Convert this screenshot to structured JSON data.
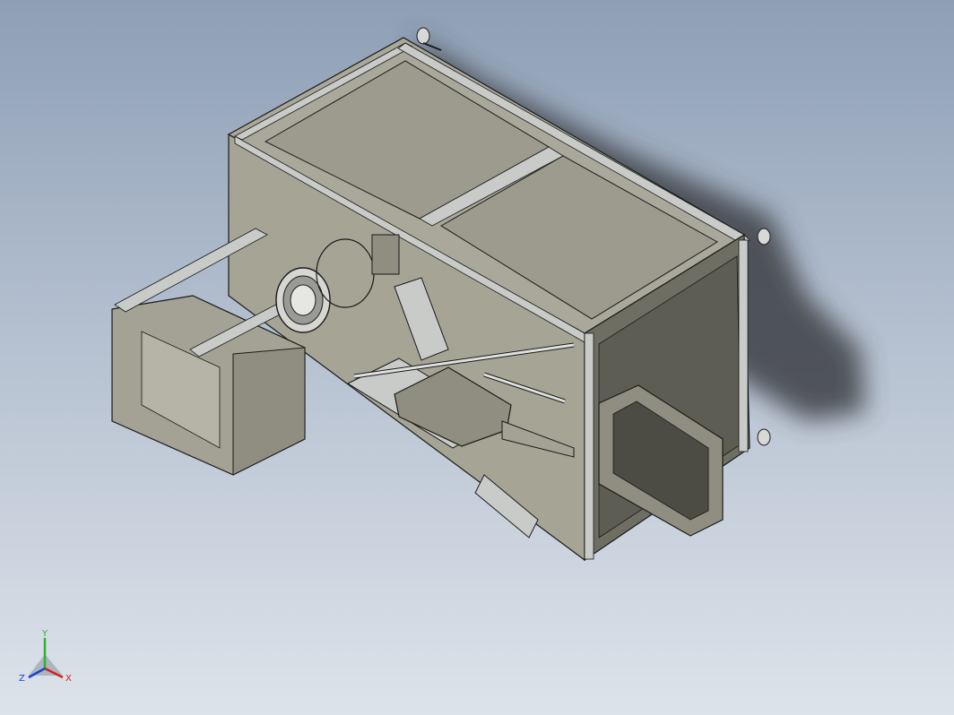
{
  "viewport": {
    "background_top": "#8e9fb5",
    "background_bottom": "#dde3ea"
  },
  "colors": {
    "panel_light": "#a9a89a",
    "panel_mid": "#8f8e80",
    "panel_dark": "#6f6e63",
    "frame": "#c9cbc9",
    "line": "#1a1a1a",
    "shadow": "#3d3f45"
  },
  "triad": {
    "y_label": "Y",
    "x_label": "X",
    "z_label": "Z",
    "y_color": "#2db32d",
    "x_color": "#d42020",
    "z_color": "#2040d0"
  }
}
